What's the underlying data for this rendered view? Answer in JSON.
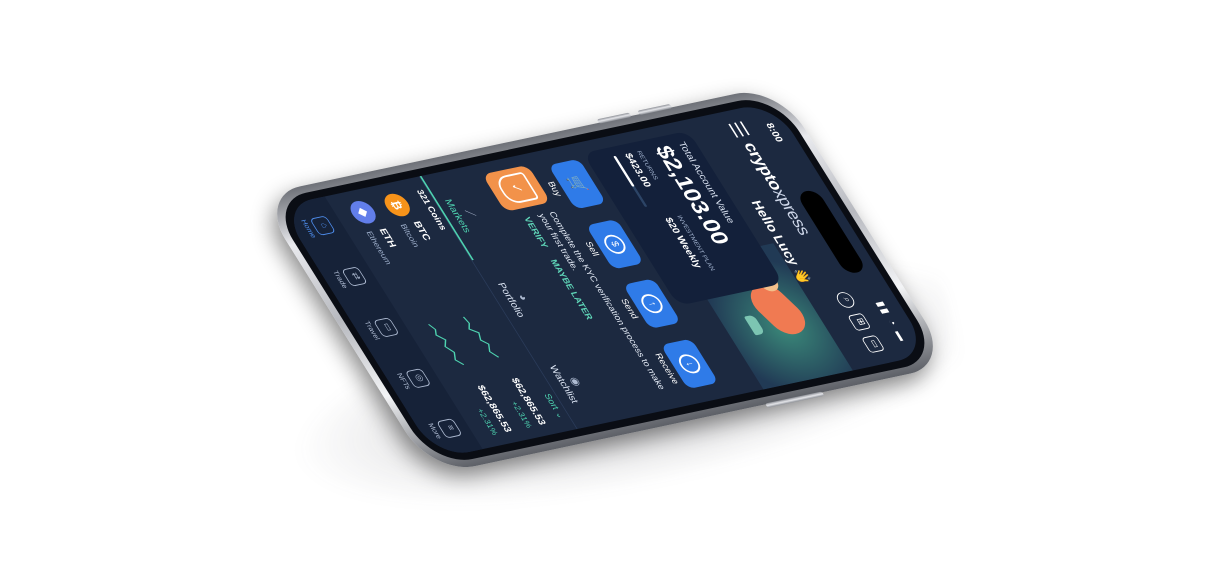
{
  "status": {
    "time": "8:00",
    "indicators": "▮▮ ◔ ▬"
  },
  "app": {
    "logo_bold": "crypto",
    "logo_thin": "xpress",
    "greeting": "Hello Lucy 👋"
  },
  "header_icons": [
    "search-icon",
    "scan-icon",
    "wallet-icon"
  ],
  "account": {
    "label": "Total Account Value",
    "value": "$2,103.00",
    "returns_label": "RETURNS",
    "returns_value": "$423.00",
    "plan_label": "INVESTMENT PLAN",
    "plan_value": "$20 Weekly",
    "plan_progress": 0.6
  },
  "actions": [
    {
      "label": "Buy",
      "icon": "cart-icon"
    },
    {
      "label": "Sell",
      "icon": "dollar-icon"
    },
    {
      "label": "Send",
      "icon": "arrow-up-icon"
    },
    {
      "label": "Receive",
      "icon": "arrow-down-icon"
    }
  ],
  "kyc": {
    "text": "Complete the KYC verification process to make your first trade.",
    "verify": "VERIFY",
    "later": "MAYBE LATER"
  },
  "tabs": [
    {
      "label": "Markets",
      "active": true
    },
    {
      "label": "Portfolio",
      "active": false
    },
    {
      "label": "Watchlist",
      "active": false
    }
  ],
  "list": {
    "count": "321 Coins",
    "sort": "Sort ⌄"
  },
  "coins": [
    {
      "symbol": "BTC",
      "name": "Bitcoin",
      "price": "$62,865.53",
      "change": "+2.31%",
      "color": "#f7931a",
      "glyph": "₿"
    },
    {
      "symbol": "ETH",
      "name": "Ethereum",
      "price": "$62,865.53",
      "change": "+2.31%",
      "color": "#627eea",
      "glyph": "◆"
    }
  ],
  "nav": [
    {
      "label": "Home",
      "active": true
    },
    {
      "label": "Trade",
      "active": false
    },
    {
      "label": "Travel",
      "active": false
    },
    {
      "label": "NFTs",
      "active": false
    },
    {
      "label": "More",
      "active": false
    }
  ]
}
